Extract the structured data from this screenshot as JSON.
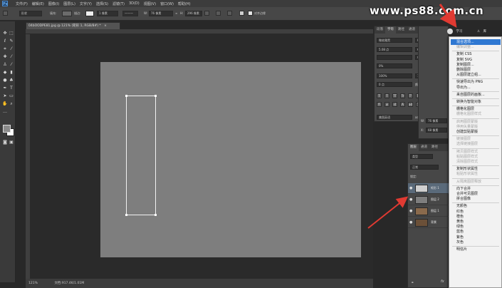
{
  "watermark": "www.ps88.com.cn",
  "menubar": {
    "logo": "Ps",
    "items": [
      "文件(F)",
      "编辑(E)",
      "图像(I)",
      "图层(L)",
      "文字(Y)",
      "选择(S)",
      "滤镜(T)",
      "3D(D)",
      "视图(V)",
      "窗口(W)",
      "帮助(H)"
    ]
  },
  "options": {
    "shape_mode": "形状",
    "fill_label": "填充:",
    "stroke_label": "描边:",
    "stroke_width": "1 像素",
    "w_label": "W:",
    "w_value": "76 像素",
    "h_label": "H:",
    "h_value": "296 像素",
    "align_edges": "对齐边缘"
  },
  "document": {
    "tab_title": "04bOODPE81.jpg @ 121% (矩形 1, RGB/8#) *",
    "close": "×"
  },
  "status": {
    "zoom": "121%",
    "doc_size": "文档:917.4K/1.01M"
  },
  "char_panel": {
    "tabs": [
      "段落",
      "字符",
      "路径",
      "通道",
      "历史"
    ],
    "font_family": "微软雅黑",
    "font_style": "Regular",
    "size": "5.08 点",
    "leading": "6.64 点",
    "kerning": "0%",
    "tracking": "0",
    "vscale": "100%",
    "hscale": "100%",
    "baseline": "0 点",
    "color_label": "颜色:",
    "style_buttons": [
      "T",
      "T",
      "TT",
      "Tr",
      "T'",
      "T,",
      "T",
      "T"
    ],
    "opentype_buttons": [
      "fi",
      "ø",
      "st",
      "A",
      "ad",
      "T",
      "1st",
      "½"
    ],
    "language": "美国英语",
    "aa": "锐利",
    "aa_label": "aa"
  },
  "prop_panel": {
    "w_label": "W:",
    "w_value": "76 像素",
    "h_label": "H:",
    "h_value": "68 像素",
    "x_label": "X:",
    "y_label": "Y:"
  },
  "right_top": {
    "learn": "学习",
    "library": "库"
  },
  "layers": {
    "tabs": [
      "图层",
      "通道",
      "路径"
    ],
    "kind": "类型",
    "blend": "正常",
    "lock": "锁定:",
    "rows": [
      {
        "name": "矩形 1",
        "selected": true
      },
      {
        "name": "图层 2",
        "selected": false
      },
      {
        "name": "图层 1",
        "selected": false
      },
      {
        "name": "背景",
        "selected": false
      }
    ],
    "footer": "fx"
  },
  "context_menu": {
    "items": [
      {
        "label": "混合选项...",
        "disabled": false,
        "highlight": true
      },
      {
        "label": "编辑调整...",
        "disabled": true
      },
      {
        "sep": true
      },
      {
        "label": "复制 CSS",
        "disabled": false
      },
      {
        "label": "复制 SVG",
        "disabled": false
      },
      {
        "label": "复制图层...",
        "disabled": false
      },
      {
        "label": "删除图层",
        "disabled": false
      },
      {
        "label": "从图层建立组...",
        "disabled": false
      },
      {
        "sep": true
      },
      {
        "label": "快速导出为 PNG",
        "disabled": false
      },
      {
        "label": "导出为...",
        "disabled": false
      },
      {
        "sep": true
      },
      {
        "label": "来自图层的画板...",
        "disabled": false
      },
      {
        "sep": true
      },
      {
        "label": "转换为智能对象",
        "disabled": false
      },
      {
        "sep": true
      },
      {
        "label": "栅格化图层",
        "disabled": false
      },
      {
        "label": "栅格化图层样式",
        "disabled": true
      },
      {
        "sep": true
      },
      {
        "label": "启用图层蒙版",
        "disabled": true
      },
      {
        "label": "停用矢量蒙版",
        "disabled": true
      },
      {
        "label": "创建剪贴蒙版",
        "disabled": false
      },
      {
        "sep": true
      },
      {
        "label": "链接图层",
        "disabled": true
      },
      {
        "label": "选择链接图层",
        "disabled": true
      },
      {
        "sep": true
      },
      {
        "label": "拷贝图层样式",
        "disabled": true
      },
      {
        "label": "粘贴图层样式",
        "disabled": true
      },
      {
        "label": "清除图层样式",
        "disabled": true
      },
      {
        "sep": true
      },
      {
        "label": "复制形状属性",
        "disabled": false
      },
      {
        "label": "粘贴形状属性",
        "disabled": true
      },
      {
        "sep": true
      },
      {
        "label": "从隔离图层释放",
        "disabled": true
      },
      {
        "sep": true
      },
      {
        "label": "向下合并",
        "disabled": false
      },
      {
        "label": "合并可见图层",
        "disabled": false
      },
      {
        "label": "拼合图像",
        "disabled": false
      },
      {
        "sep": true
      },
      {
        "label": "无颜色",
        "disabled": false
      },
      {
        "label": "红色",
        "disabled": false
      },
      {
        "label": "橙色",
        "disabled": false
      },
      {
        "label": "黄色",
        "disabled": false
      },
      {
        "label": "绿色",
        "disabled": false
      },
      {
        "label": "蓝色",
        "disabled": false
      },
      {
        "label": "紫色",
        "disabled": false
      },
      {
        "label": "灰色",
        "disabled": false
      },
      {
        "sep": true
      },
      {
        "label": "明信片",
        "disabled": false
      }
    ]
  },
  "colors": {
    "highlight": "#2f78d2",
    "arrow": "#e03a32"
  }
}
